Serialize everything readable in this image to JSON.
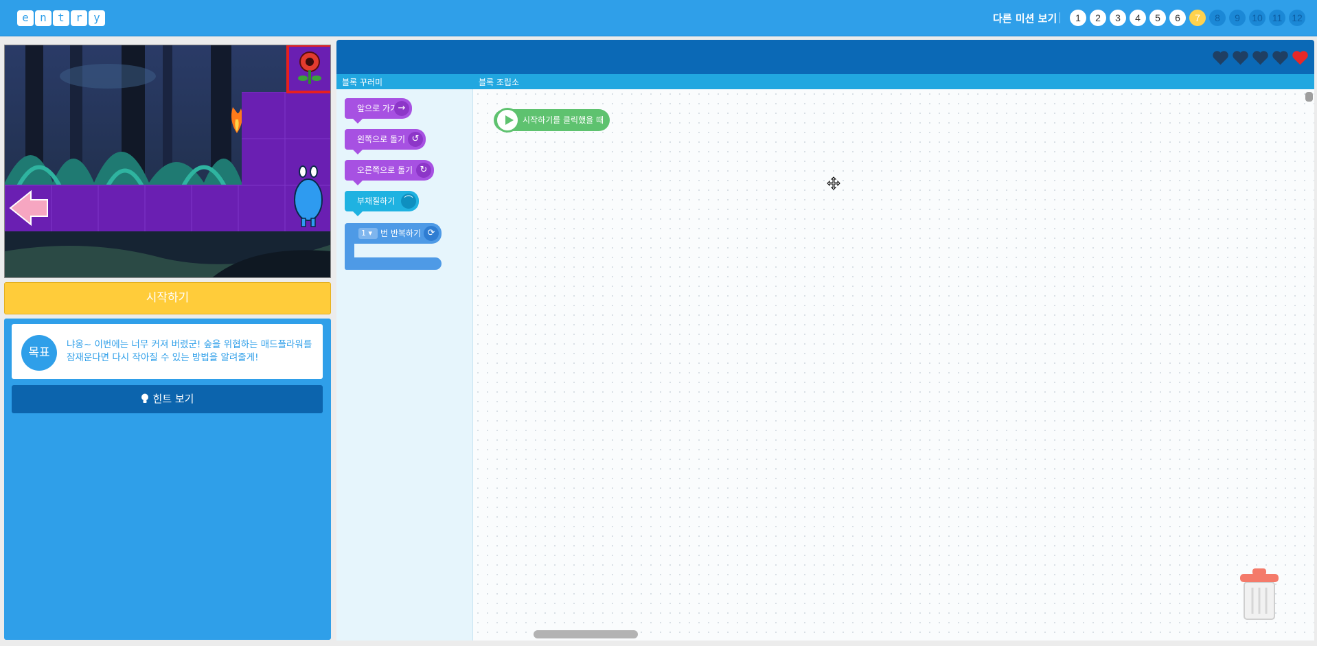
{
  "header": {
    "logo_letters": [
      "e",
      "n",
      "t",
      "r",
      "y"
    ],
    "other_missions_label": "다른 미션 보기",
    "missions": [
      {
        "num": "1",
        "state": "done"
      },
      {
        "num": "2",
        "state": "done"
      },
      {
        "num": "3",
        "state": "done"
      },
      {
        "num": "4",
        "state": "done"
      },
      {
        "num": "5",
        "state": "done"
      },
      {
        "num": "6",
        "state": "done"
      },
      {
        "num": "7",
        "state": "current"
      },
      {
        "num": "8",
        "state": "locked"
      },
      {
        "num": "9",
        "state": "locked"
      },
      {
        "num": "10",
        "state": "locked"
      },
      {
        "num": "11",
        "state": "locked"
      },
      {
        "num": "12",
        "state": "locked"
      }
    ]
  },
  "left": {
    "start_button": "시작하기",
    "goal_badge": "목표",
    "goal_text": "냐옹~ 이번에는 너무 커져 버렸군! 숲을 위협하는 매드플라워를 잠재운다면 다시 작아질 수 있는 방법을 알려줄게!",
    "hint_button": "힌트 보기"
  },
  "workspace": {
    "palette_title": "블록 꾸러미",
    "board_title": "블록 조립소",
    "lives": {
      "total": 5,
      "remaining": 1
    },
    "palette_blocks": {
      "forward": "앞으로 가기",
      "turn_left": "왼쪽으로 돌기",
      "turn_right": "오른쪽으로 돌기",
      "fan": "부채질하기",
      "repeat_count": "1",
      "repeat_label": "번 반복하기"
    },
    "start_block_label": "시작하기를 클릭했을 때"
  },
  "colors": {
    "topbar": "#2f9fe9",
    "current_mission": "#ffd24d",
    "start_button": "#ffcc3a",
    "purple_block": "#a751e2",
    "cyan_block": "#1fb2e1",
    "blue_block": "#4e9ae6",
    "start_block": "#5ec26f",
    "heart_full": "#e82828",
    "heart_empty": "#1f3f63"
  }
}
